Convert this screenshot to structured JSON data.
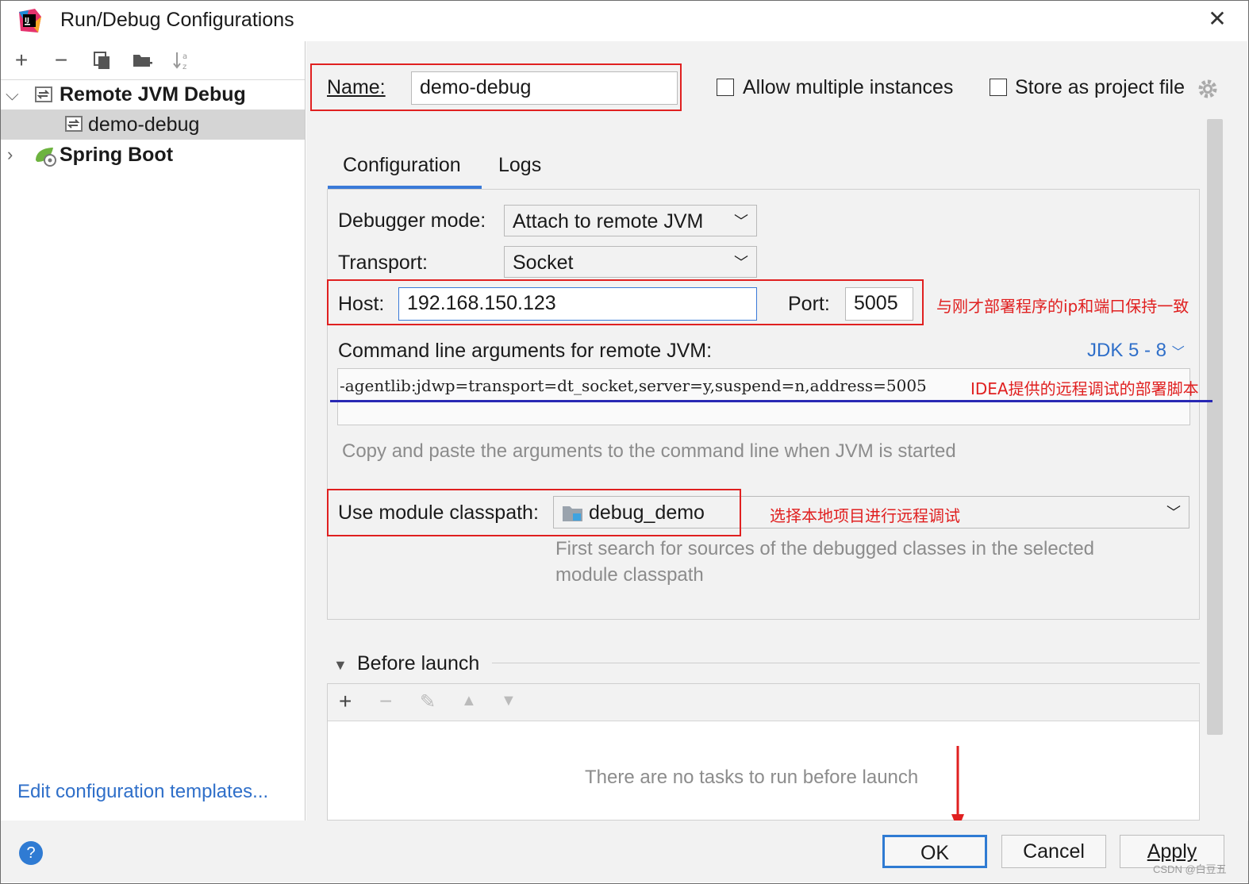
{
  "window": {
    "title": "Run/Debug Configurations"
  },
  "sidebar": {
    "toolbar": [
      "add-icon",
      "remove-icon",
      "copy-icon",
      "folder-add-icon",
      "sort-icon"
    ],
    "tree": [
      {
        "label": "Remote JVM Debug",
        "expanded": true
      },
      {
        "label": "demo-debug",
        "selected": true
      },
      {
        "label": "Spring Boot",
        "expanded": false
      }
    ],
    "edit_templates": "Edit configuration templates..."
  },
  "header": {
    "name_label": "Name:",
    "name_value": "demo-debug",
    "allow_multiple": "Allow multiple instances",
    "store_as_project": "Store as project file"
  },
  "tabs": [
    {
      "label": "Configuration",
      "active": true
    },
    {
      "label": "Logs",
      "active": false
    }
  ],
  "config": {
    "debugger_mode_label": "Debugger mode:",
    "debugger_mode_value": "Attach to remote JVM",
    "transport_label": "Transport:",
    "transport_value": "Socket",
    "host_label": "Host:",
    "host_value": "192.168.150.123",
    "port_label": "Port:",
    "port_value": "5005",
    "cmd_label": "Command line arguments for remote JVM:",
    "jdk_value": "JDK 5 - 8",
    "cmd_value": "-agentlib:jdwp=transport=dt_socket,server=y,suspend=n,address=5005",
    "cmd_hint": "Copy and paste the arguments to the command line when JVM is started",
    "module_label": "Use module classpath:",
    "module_value": "debug_demo",
    "module_hint_1": "First search for sources of the debugged classes in the selected",
    "module_hint_2": "module classpath"
  },
  "annotations": {
    "host_port": "与刚才部署程序的ip和端口保持一致",
    "cmd": "IDEA提供的远程调试的部署脚本",
    "module": "选择本地项目进行远程调试"
  },
  "before_launch": {
    "title": "Before launch",
    "empty_text": "There are no tasks to run before launch"
  },
  "footer": {
    "ok": "OK",
    "cancel": "Cancel",
    "apply": "Apply",
    "watermark": "CSDN @白豆五"
  },
  "colors": {
    "accent": "#2f6fc9",
    "annotation": "#e02020",
    "underline_blue": "#2828b4"
  }
}
